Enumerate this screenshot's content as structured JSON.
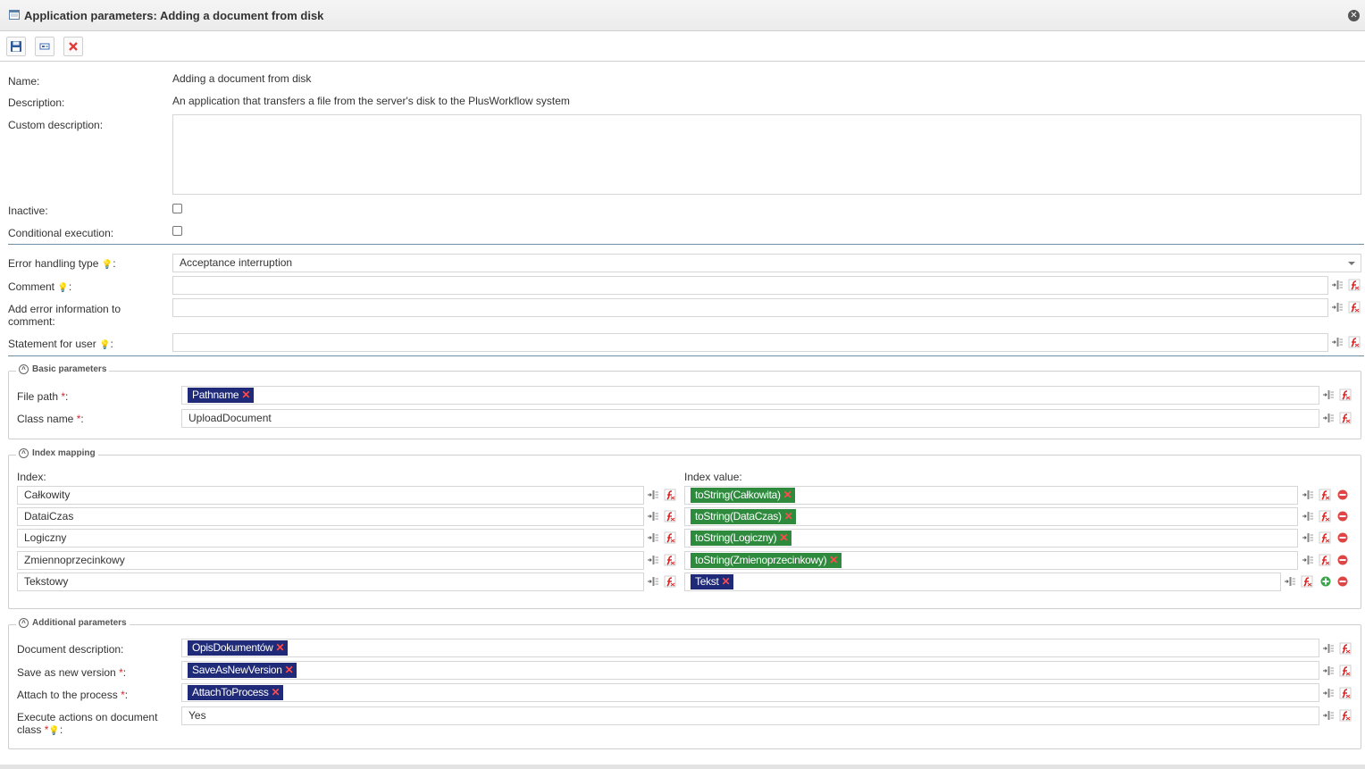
{
  "window": {
    "title": "Application parameters: Adding a document from disk",
    "icon": "window-icon"
  },
  "toolbar": {
    "save_icon": "floppy-disk-icon",
    "preview_icon": "preview-icon",
    "close_icon": "red-x-icon"
  },
  "general": {
    "name_label": "Name:",
    "name_value": "Adding a document from disk",
    "description_label": "Description:",
    "description_value": "An application that transfers a file from the server's disk to the PlusWorkflow system",
    "custom_description_label": "Custom description:",
    "custom_description_value": "",
    "inactive_label": "Inactive:",
    "inactive_checked": false,
    "conditional_label": "Conditional execution:",
    "conditional_checked": false
  },
  "errors": {
    "error_type_label": "Error handling type",
    "error_type_value": "Acceptance interruption",
    "comment_label": "Comment",
    "comment_value": "",
    "add_error_label_1": "Add error information to",
    "add_error_label_2": "comment:",
    "add_error_value": "",
    "statement_label": "Statement for user",
    "statement_value": ""
  },
  "basic": {
    "legend": "Basic parameters",
    "file_path_label": "File path",
    "file_path_chip": "Pathname",
    "class_name_label": "Class name",
    "class_name_value": "UploadDocument"
  },
  "index_mapping": {
    "legend": "Index mapping",
    "index_header": "Index:",
    "value_header": "Index value:",
    "rows": [
      {
        "index": "Całkowity",
        "value": "toString(Całkowita)",
        "chip_color": "green"
      },
      {
        "index": "DataiCzas",
        "value": "toString(DataCzas)",
        "chip_color": "green"
      },
      {
        "index": "Logiczny",
        "value": "toString(Logiczny)",
        "chip_color": "green"
      },
      {
        "index": "Zmiennoprzecinkowy",
        "value": "toString(Zmienoprzecinkowy)",
        "chip_color": "green"
      },
      {
        "index": "Tekstowy",
        "value": "Tekst",
        "chip_color": "blue"
      }
    ]
  },
  "additional": {
    "legend": "Additional parameters",
    "doc_desc_label": "Document description:",
    "doc_desc_chip": "OpisDokumentów",
    "save_new_label": "Save as new version",
    "save_new_chip": "SaveAsNewVersion",
    "attach_label": "Attach to the process",
    "attach_chip": "AttachToProcess",
    "execute_label_1": "Execute actions on document",
    "execute_label_2": "class",
    "execute_value": "Yes"
  },
  "markers": {
    "required": "*",
    "colon": ":",
    "chip_remove": "✕"
  },
  "colors": {
    "chip_blue": "#1f2a78",
    "chip_green": "#2e8b3e",
    "required_red": "#d9262b",
    "separator": "#6f8fa3"
  }
}
